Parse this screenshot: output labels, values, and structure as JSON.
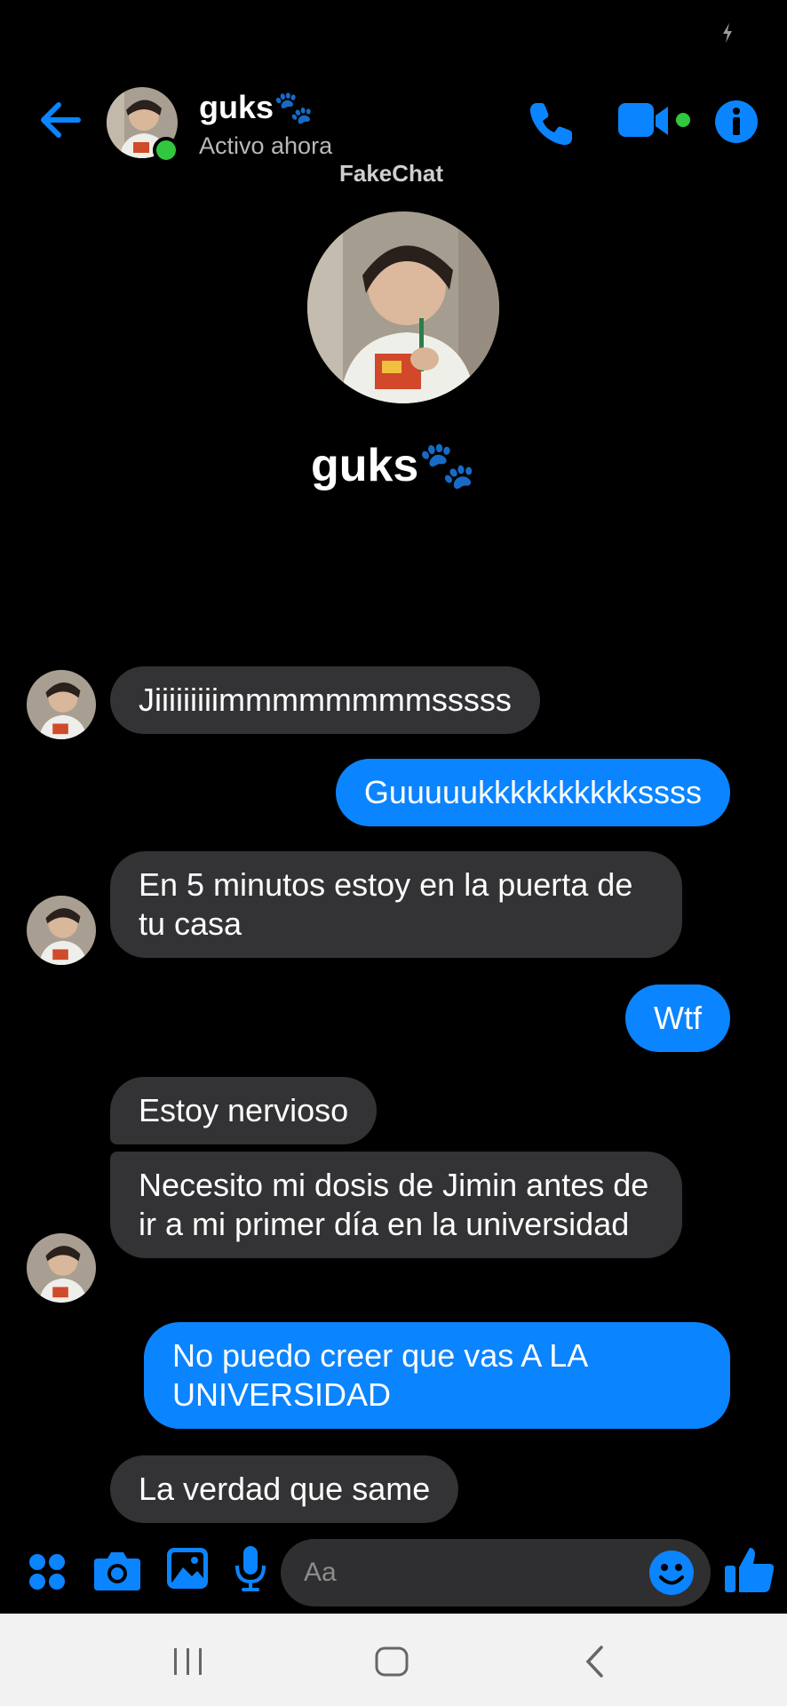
{
  "header": {
    "name": "guks🐾",
    "status": "Activo ahora",
    "watermark": "FakeChat"
  },
  "profile": {
    "name": "guks🐾"
  },
  "messages": [
    {
      "from": "them",
      "text": "Jiiiiiiiiimmmmmmmmsssss"
    },
    {
      "from": "me",
      "text": "Guuuuukkkkkkkkkkssss"
    },
    {
      "from": "them",
      "text": "En 5 minutos estoy en la puerta de tu casa"
    },
    {
      "from": "me",
      "text": "Wtf"
    },
    {
      "from": "them",
      "text": "Estoy nervioso"
    },
    {
      "from": "them",
      "text": "Necesito mi dosis de Jimin antes de ir a mi primer día en la universidad"
    },
    {
      "from": "me",
      "text": "No puedo creer que vas A LA UNIVERSIDAD"
    },
    {
      "from": "them",
      "text": "La verdad que same"
    }
  ],
  "composer": {
    "placeholder": "Aa"
  },
  "icons": {
    "back": "arrow-left-icon",
    "call": "phone-icon",
    "video": "video-camera-icon",
    "info": "info-icon",
    "apps": "grid-dots-icon",
    "camera": "camera-icon",
    "gallery": "image-icon",
    "mic": "microphone-icon",
    "emoji": "smiley-icon",
    "like": "thumbs-up-icon"
  },
  "colors": {
    "accent": "#0b84ff",
    "incoming_bubble": "#333335",
    "background": "#000000",
    "online": "#31c83f"
  }
}
